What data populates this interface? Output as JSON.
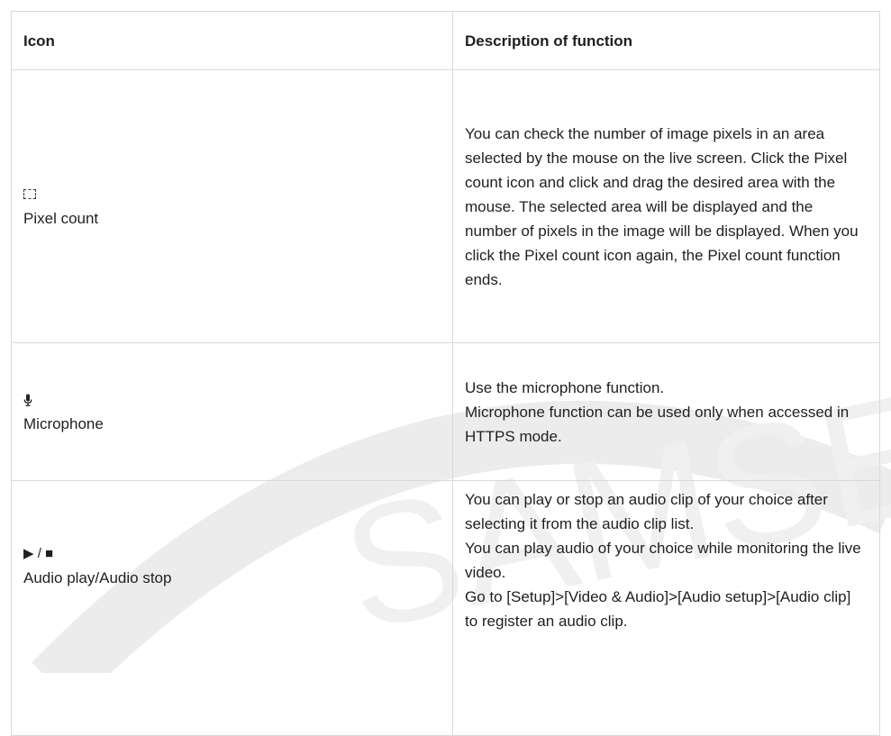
{
  "watermark": "SAMSE",
  "table": {
    "headers": {
      "icon": "Icon",
      "description": "Description of function"
    },
    "rows": [
      {
        "icon_glyph": "pixel-count-icon",
        "name": "Pixel count",
        "description": [
          "You can check the number of image pixels in an area selected by the mouse on the live screen. Click the Pixel count icon and click and drag the desired area with the mouse. The selected area will be displayed and the number of pixels in the image will be displayed. When you click the Pixel count icon again, the Pixel count function ends."
        ]
      },
      {
        "icon_glyph": "microphone-icon",
        "name": "Microphone",
        "description": [
          "Use the microphone function.",
          "Microphone function can be used only when accessed in HTTPS mode."
        ]
      },
      {
        "icon_glyph": "▶ / ■",
        "name": "Audio play/Audio stop",
        "description": [
          "You can play or stop an audio clip of your choice after selecting it from the audio clip list.",
          "You can play audio of your choice while monitoring the live video.",
          "Go to [Setup]>[Video & Audio]>[Audio setup]>[Audio clip] to register an audio clip."
        ]
      }
    ]
  }
}
